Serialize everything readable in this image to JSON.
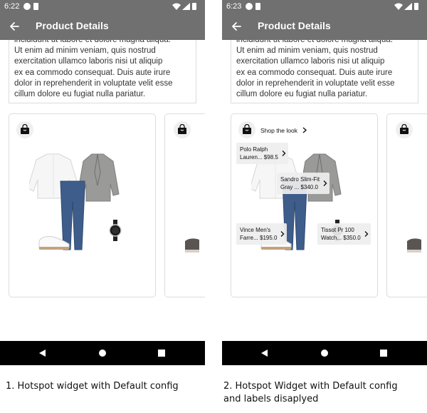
{
  "phones": [
    {
      "status_time": "6:22",
      "app_title": "Product Details",
      "description_lines": [
        "incididunt ut labore et dolore magna aliqua.",
        "Ut enim ad minim veniam, quis nostrud",
        "exercitation ullamco laboris nisi ut aliquip",
        "ex ea commodo consequat. Duis aute irure",
        "dolor in reprehenderit in voluptate velit esse",
        "cillum dolore eu fugiat nulla pariatur."
      ],
      "caption": "1. Hotspot widget with Default config"
    },
    {
      "status_time": "6:23",
      "app_title": "Product Details",
      "description_lines": [
        "incididunt ut labore et dolore magna aliqua.",
        "Ut enim ad minim veniam, quis nostrud",
        "exercitation ullamco laboris nisi ut aliquip",
        "ex ea commodo consequat. Duis aute irure",
        "dolor in reprehenderit in voluptate velit esse",
        "cillum dolore eu fugiat nulla pariatur."
      ],
      "shop_the_look": "Shop the look",
      "hotspots": [
        {
          "line1": "Polo Ralph",
          "line2": "Lauren... $98.5"
        },
        {
          "line1": "Sandro Slim-Fit",
          "line2": "Gray ... $340.0"
        },
        {
          "line1": "Vince Men's",
          "line2": "Farre... $195.0"
        },
        {
          "line1": "Tissot Pr 100",
          "line2": "Watch... $350.0"
        }
      ],
      "caption": "2. Hotspot Widget with Default config and labels disaplyed"
    }
  ],
  "icons": {
    "back": "arrow-back-icon",
    "bag": "shopping-bag-icon",
    "chevron": "chevron-right-icon",
    "wifi": "wifi-icon",
    "signal": "signal-icon",
    "battery": "battery-icon"
  },
  "colors": {
    "app_bar": "#707070",
    "nav_bar": "#000000",
    "card_border": "#dcdcdc",
    "jeans": "#3f5d8a",
    "blazer": "#9a9a98"
  }
}
